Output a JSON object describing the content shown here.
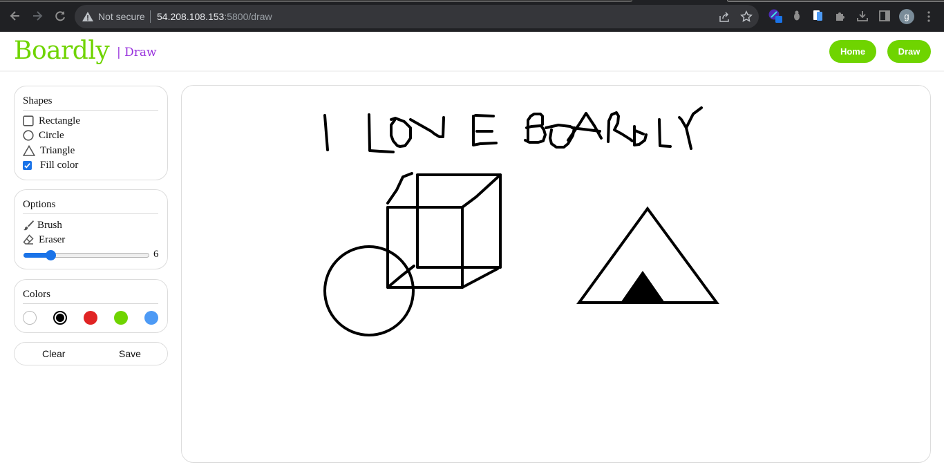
{
  "browser": {
    "security_label": "Not secure",
    "url_host": "54.208.108.153",
    "url_rest": ":5800/draw",
    "profile_initial": "g",
    "icons": [
      "back-icon",
      "forward-icon",
      "reload-icon",
      "warning-icon",
      "share-icon",
      "star-icon",
      "color-picker-extension-icon",
      "bug-extension-icon",
      "tabs-extension-icon",
      "puzzle-icon",
      "download-icon",
      "side-panel-icon",
      "menu-dots-icon"
    ]
  },
  "header": {
    "logo": "Boardly",
    "subtitle": "| Draw",
    "nav": [
      {
        "label": "Home"
      },
      {
        "label": "Draw"
      }
    ],
    "brand_color": "#6fd400",
    "subtitle_color": "#9933dd"
  },
  "sidebar": {
    "shapes": {
      "title": "Shapes",
      "items": [
        {
          "label": "Rectangle",
          "icon": "square-icon"
        },
        {
          "label": "Circle",
          "icon": "circle-icon"
        },
        {
          "label": "Triangle",
          "icon": "triangle-icon"
        }
      ],
      "fill_color": {
        "label": "Fill color",
        "checked": true
      }
    },
    "options": {
      "title": "Options",
      "items": [
        {
          "label": "Brush",
          "icon": "brush-icon"
        },
        {
          "label": "Eraser",
          "icon": "eraser-icon"
        }
      ],
      "brush_size": {
        "value": "6",
        "min": 1,
        "max": 50,
        "current": 6
      }
    },
    "colors": {
      "title": "Colors",
      "swatches": [
        {
          "name": "white",
          "hex": "#ffffff",
          "selected": false
        },
        {
          "name": "black",
          "hex": "#000000",
          "selected": true
        },
        {
          "name": "red",
          "hex": "#e02424",
          "selected": false
        },
        {
          "name": "green",
          "hex": "#6fd400",
          "selected": false
        },
        {
          "name": "blue",
          "hex": "#4d9af5",
          "selected": false
        }
      ]
    },
    "actions": {
      "clear": "Clear",
      "save": "Save"
    }
  },
  "canvas": {
    "drawn_text": "I LOVE BOARDLY",
    "stroke_color": "#000000"
  }
}
